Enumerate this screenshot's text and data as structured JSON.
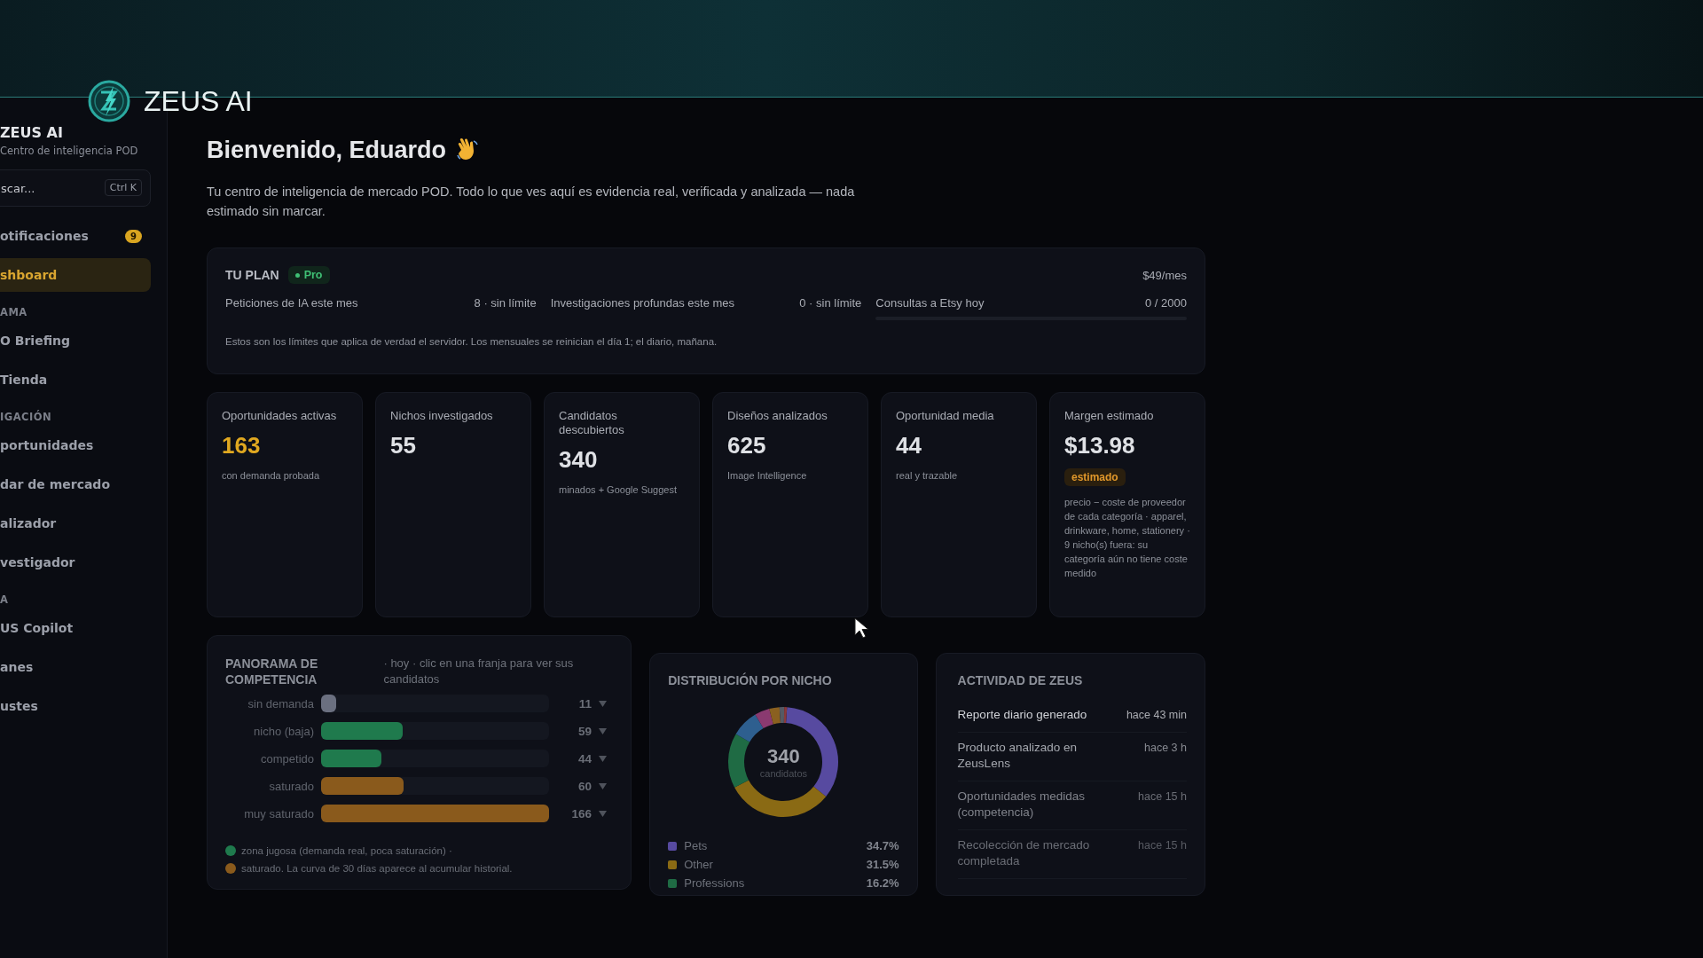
{
  "app": {
    "name": "ZEUS AI"
  },
  "sidebar": {
    "title": "ZEUS AI",
    "subtitle": "Centro de inteligencia POD",
    "search": {
      "placeholder": "scar...",
      "shortcut": "Ctrl K"
    },
    "items": [
      {
        "kind": "item",
        "label": "otificaciones",
        "badge": "9",
        "selected": false
      },
      {
        "kind": "item",
        "label": "shboard",
        "selected": true
      },
      {
        "kind": "section",
        "label": "AMA"
      },
      {
        "kind": "item",
        "label": "O Briefing",
        "selected": false
      },
      {
        "kind": "item",
        "label": "Tienda",
        "selected": false
      },
      {
        "kind": "section",
        "label": "IGACIÓN"
      },
      {
        "kind": "item",
        "label": "portunidades",
        "selected": false
      },
      {
        "kind": "item",
        "label": "dar de mercado",
        "selected": false
      },
      {
        "kind": "item",
        "label": "alizador",
        "selected": false
      },
      {
        "kind": "item",
        "label": "vestigador",
        "selected": false
      },
      {
        "kind": "section",
        "label": "A"
      },
      {
        "kind": "item",
        "label": "US Copilot",
        "selected": false
      },
      {
        "kind": "item",
        "label": "anes",
        "selected": false
      },
      {
        "kind": "item",
        "label": "ustes",
        "selected": false
      }
    ]
  },
  "header": {
    "title": "Bienvenido, Eduardo",
    "intro": "Tu centro de inteligencia de mercado POD. Todo lo que ves aquí es evidencia real, verificada y analizada — nada estimado sin marcar."
  },
  "plan": {
    "label": "TU PLAN",
    "tier": "Pro",
    "price": "$49/mes",
    "limits": [
      {
        "label": "Peticiones de IA este mes",
        "value": "8 · sin límite"
      },
      {
        "label": "Investigaciones profundas este mes",
        "value": "0 · sin límite"
      },
      {
        "label": "Consultas a Etsy hoy",
        "value": "0 / 2000",
        "level": 0
      }
    ],
    "note": "Estos son los límites que aplica de verdad el servidor. Los mensuales se reinician el día 1; el diario, mañana."
  },
  "stats": [
    {
      "label": "Oportunidades activas",
      "value": "163",
      "highlighted": true,
      "caption": "con demanda probada"
    },
    {
      "label": "Nichos investigados",
      "value": "55",
      "highlighted": false
    },
    {
      "label": "Candidatos descubiertos",
      "value": "340",
      "highlighted": false,
      "caption": "minados + Google Suggest"
    },
    {
      "label": "Diseños analizados",
      "value": "625",
      "highlighted": false,
      "caption": "Image Intelligence"
    },
    {
      "label": "Oportunidad media",
      "value": "44",
      "highlighted": false,
      "caption": "real y trazable"
    },
    {
      "label": "Margen estimado",
      "value": "$13.98",
      "highlighted": false,
      "badge": "estimado",
      "caption": "precio − coste de proveedor de cada categoría · apparel, drinkware, home, stationery · 9 nicho(s) fuera: su categoría aún no tiene coste medido"
    }
  ],
  "competition": {
    "title": "PANORAMA DE COMPETENCIA",
    "subtitle": "· hoy · clic en una franja para ver sus candidatos",
    "bands": [
      {
        "label": "sin demanda",
        "count": "11",
        "level": 0.066,
        "color": "#6b7080"
      },
      {
        "label": "nicho (baja)",
        "count": "59",
        "level": 0.357,
        "color": "#1f7a4d"
      },
      {
        "label": "competido",
        "count": "44",
        "level": 0.266,
        "color": "#1f7a4d"
      },
      {
        "label": "saturado",
        "count": "60",
        "level": 0.362,
        "color": "#8a5a1c"
      },
      {
        "label": "muy saturado",
        "count": "166",
        "level": 1,
        "color": "#8a5a1c"
      }
    ],
    "legend": [
      {
        "text": "zona jugosa (demanda real, poca saturación) ·",
        "color": "#1f7a4d"
      },
      {
        "text": "saturado. La curva de 30 días aparece al acumular historial.",
        "color": "#8a5a1c"
      }
    ]
  },
  "distribution": {
    "title": "DISTRIBUCIÓN POR NICHO",
    "total": "340",
    "total_label": "candidatos",
    "legend": [
      {
        "label": "Pets",
        "value": "34.7%",
        "color": "#574aa0"
      },
      {
        "label": "Other",
        "value": "31.5%",
        "color": "#8a6a14"
      },
      {
        "label": "Professions",
        "value": "16.2%",
        "color": "#1f6b44"
      }
    ]
  },
  "activity": {
    "title": "ACTIVIDAD DE ZEUS",
    "items": [
      {
        "text": "Reporte diario generado",
        "time": "hace 43 min"
      },
      {
        "text": "Producto analizado en ZeusLens",
        "time": "hace 3 h"
      },
      {
        "text": "Oportunidades medidas (competencia)",
        "time": "hace 15 h"
      },
      {
        "text": "Recolección de mercado completada",
        "time": "hace 15 h"
      }
    ]
  }
}
